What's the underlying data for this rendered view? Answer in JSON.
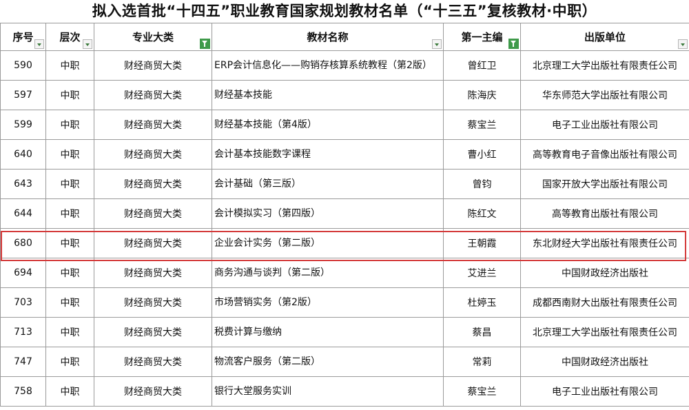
{
  "title": "拟入选首批“十四五”职业教育国家规划教材名单（“十三五”复核教材·中职）",
  "columns": [
    {
      "label": "序号",
      "filter": "dropdown"
    },
    {
      "label": "层次",
      "filter": "dropdown"
    },
    {
      "label": "专业大类",
      "filter": "active"
    },
    {
      "label": "教材名称",
      "filter": "dropdown"
    },
    {
      "label": "第一主编",
      "filter": "active"
    },
    {
      "label": "出版单位",
      "filter": "dropdown"
    }
  ],
  "rows": [
    {
      "no": "590",
      "level": "中职",
      "category": "财经商贸大类",
      "name": "ERP会计信息化——购销存核算系统教程（第2版）",
      "editor": "曾红卫",
      "publisher": "北京理工大学出版社有限责任公司"
    },
    {
      "no": "597",
      "level": "中职",
      "category": "财经商贸大类",
      "name": "财经基本技能",
      "editor": "陈海庆",
      "publisher": "华东师范大学出版社有限公司"
    },
    {
      "no": "599",
      "level": "中职",
      "category": "财经商贸大类",
      "name": "财经基本技能（第4版）",
      "editor": "蔡宝兰",
      "publisher": "电子工业出版社有限公司"
    },
    {
      "no": "640",
      "level": "中职",
      "category": "财经商贸大类",
      "name": "会计基本技能数字课程",
      "editor": "曹小红",
      "publisher": "高等教育电子音像出版社有限公司"
    },
    {
      "no": "643",
      "level": "中职",
      "category": "财经商贸大类",
      "name": "会计基础（第三版）",
      "editor": "曾钧",
      "publisher": "国家开放大学出版社有限公司"
    },
    {
      "no": "644",
      "level": "中职",
      "category": "财经商贸大类",
      "name": "会计模拟实习（第四版）",
      "editor": "陈红文",
      "publisher": "高等教育出版社有限公司"
    },
    {
      "no": "680",
      "level": "中职",
      "category": "财经商贸大类",
      "name": "企业会计实务（第二版）",
      "editor": "王朝霞",
      "publisher": "东北财经大学出版社有限责任公司"
    },
    {
      "no": "694",
      "level": "中职",
      "category": "财经商贸大类",
      "name": "商务沟通与谈判（第二版）",
      "editor": "艾进兰",
      "publisher": "中国财政经济出版社"
    },
    {
      "no": "703",
      "level": "中职",
      "category": "财经商贸大类",
      "name": "市场营销实务（第2版）",
      "editor": "杜婷玉",
      "publisher": "成都西南财大出版社有限责任公司"
    },
    {
      "no": "713",
      "level": "中职",
      "category": "财经商贸大类",
      "name": "税费计算与缴纳",
      "editor": "蔡昌",
      "publisher": "北京理工大学出版社有限责任公司"
    },
    {
      "no": "747",
      "level": "中职",
      "category": "财经商贸大类",
      "name": "物流客户服务（第二版）",
      "editor": "常莉",
      "publisher": "中国财政经济出版社"
    },
    {
      "no": "758",
      "level": "中职",
      "category": "财经商贸大类",
      "name": "银行大堂服务实训",
      "editor": "蔡宝兰",
      "publisher": "电子工业出版社有限公司"
    }
  ],
  "colors": {
    "grid": "#9a9a9a",
    "highlight": "#d43a3a",
    "filter_active": "#3f9a4a"
  }
}
